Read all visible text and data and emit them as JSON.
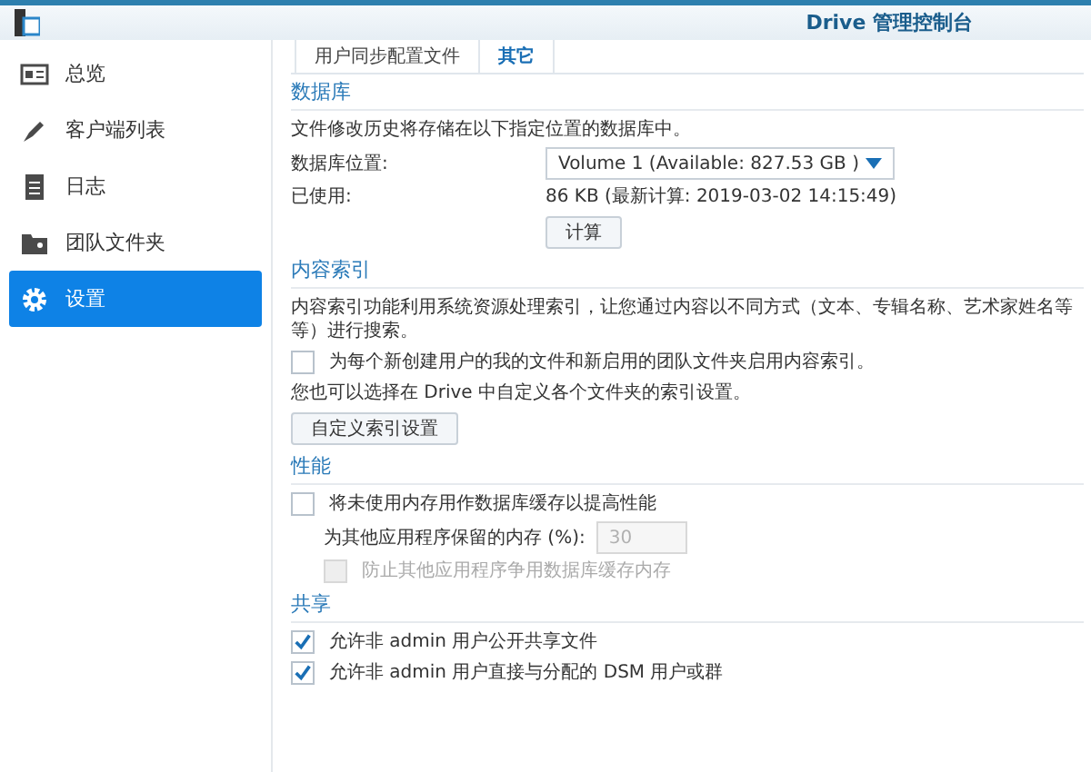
{
  "window": {
    "title": "Drive 管理控制台"
  },
  "sidebar": {
    "items": [
      {
        "label": "总览",
        "selected": false
      },
      {
        "label": "客户端列表",
        "selected": false
      },
      {
        "label": "日志",
        "selected": false
      },
      {
        "label": "团队文件夹",
        "selected": false
      },
      {
        "label": "设置",
        "selected": true
      }
    ]
  },
  "tabs": [
    {
      "label": "用户同步配置文件",
      "selected": false
    },
    {
      "label": "其它",
      "selected": true
    }
  ],
  "sections": [
    {
      "title": "数据库",
      "rows": [
        {
          "kind": "text",
          "text": "文件修改历史将存储在以下指定位置的数据库中。"
        },
        {
          "kind": "select",
          "label": "数据库位置:",
          "value": "Volume 1 (Available: 827.53 GB )"
        },
        {
          "kind": "info",
          "label": "已使用:",
          "value": "86 KB (最新计算:  2019-03-02 14:15:49)"
        },
        {
          "kind": "formbutton",
          "text": "计算"
        }
      ]
    },
    {
      "title": "内容索引",
      "rows": [
        {
          "kind": "text",
          "text": "内容索引功能利用系统资源处理索引，让您通过内容以不同方式（文本、专辑名称、艺术家姓名等等）进行搜索。"
        },
        {
          "kind": "checkbox",
          "text": "为每个新创建用户的我的文件和新启用的团队文件夹启用内容索引。",
          "checked": false,
          "disabled": false
        },
        {
          "kind": "text",
          "text": "您也可以选择在 Drive 中自定义各个文件夹的索引设置。"
        },
        {
          "kind": "button",
          "text": "自定义索引设置"
        }
      ]
    },
    {
      "title": "性能",
      "rows": [
        {
          "kind": "checkbox",
          "text": "将未使用内存用作数据库缓存以提高性能",
          "checked": false,
          "disabled": false,
          "children": [
            {
              "kind": "number",
              "label": "为其他应用程序保留的内存 (%):",
              "value": "30",
              "disabled": true
            },
            {
              "kind": "checkbox",
              "text": "防止其他应用程序争用数据库缓存内存",
              "checked": false,
              "disabled": true
            }
          ]
        }
      ]
    },
    {
      "title": "共享",
      "rows": [
        {
          "kind": "checkbox",
          "text": "允许非 admin 用户公开共享文件",
          "checked": true,
          "disabled": false
        },
        {
          "kind": "checkbox",
          "text": "允许非 admin 用户直接与分配的 DSM 用户或群",
          "checked": true,
          "disabled": false
        }
      ]
    }
  ]
}
